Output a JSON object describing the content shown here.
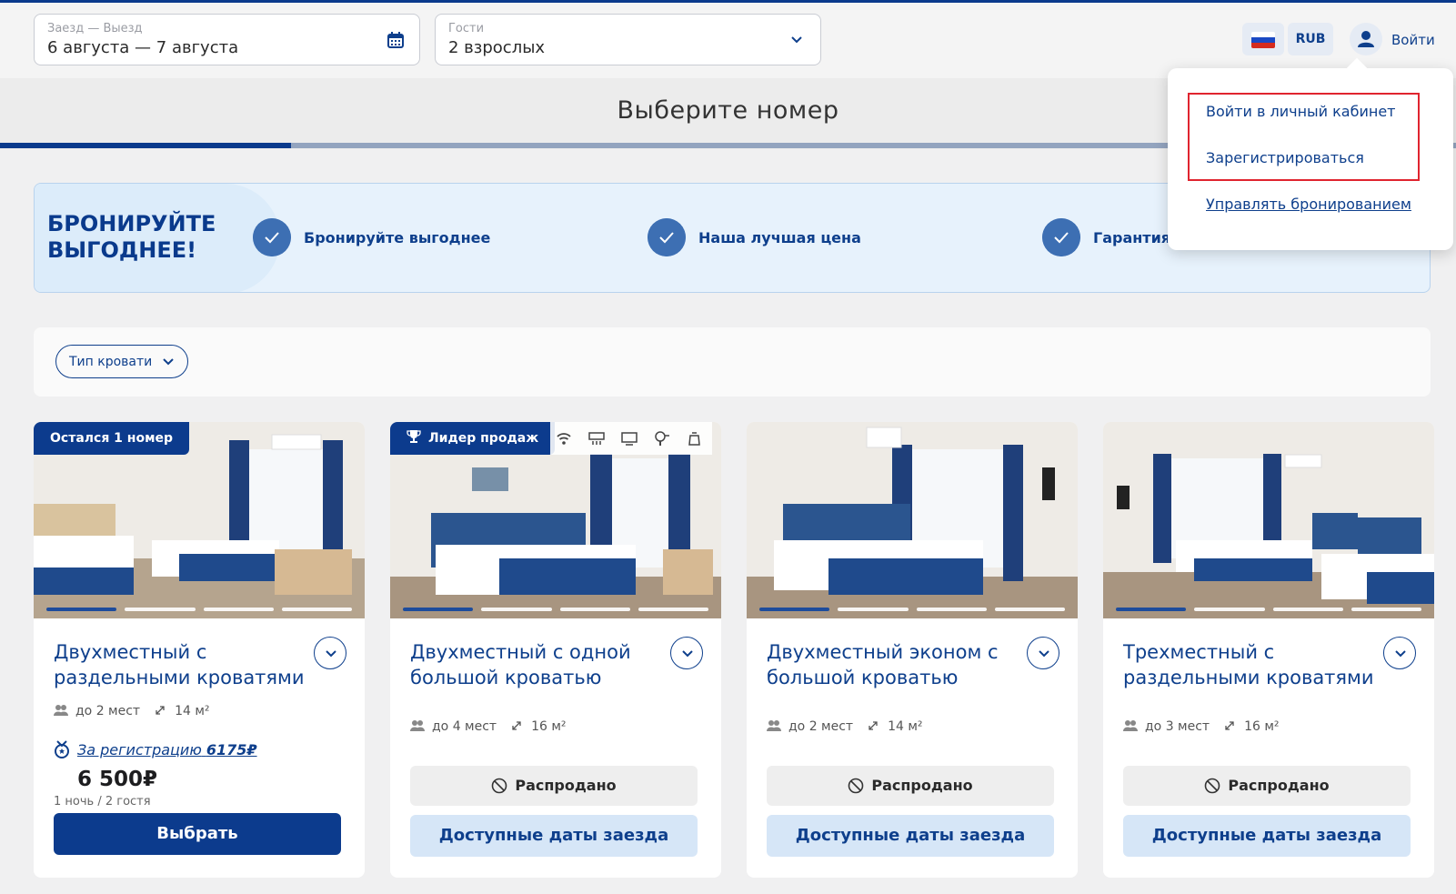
{
  "header": {
    "dates_label": "Заезд — Выезд",
    "dates_value": "6 августа — 7 августа",
    "guests_label": "Гости",
    "guests_value": "2 взрослых",
    "currency": "RUB",
    "login": "Войти"
  },
  "page_title": "Выберите номер",
  "progress_fraction": 0.2,
  "dropdown": {
    "items": [
      "Войти в личный кабинет",
      "Зарегистрироваться",
      "Управлять бронированием"
    ]
  },
  "promo": {
    "heading": "БРОНИРУЙТЕ ВЫГОДНЕЕ!",
    "perks": [
      "Бронируйте выгоднее",
      "Наша лучшая цена",
      "Гарантия"
    ]
  },
  "filters": {
    "bed_type": "Тип кровати"
  },
  "rooms": [
    {
      "badge": "Остался 1 номер",
      "title": "Двухместный с раздельными кроватями",
      "guests": "до 2 мест",
      "area": "14 м²",
      "bonus_prefix": "За регистрацию",
      "bonus_value": "6175₽",
      "price": "6 500₽",
      "per": "1 ночь / 2 гостя",
      "action": "Выбрать"
    },
    {
      "badge": "Лидер продаж",
      "title": "Двухместный с одной большой кроватью",
      "guests": "до 4 мест",
      "area": "16 м²",
      "status": "Распродано",
      "action": "Доступные даты заезда"
    },
    {
      "title": "Двухместный эконом с большой кроватью",
      "guests": "до 2 мест",
      "area": "14 м²",
      "status": "Распродано",
      "action": "Доступные даты заезда"
    },
    {
      "title": "Трехместный с раздельными кроватями",
      "guests": "до 3 мест",
      "area": "16 м²",
      "status": "Распродано",
      "action": "Доступные даты заезда"
    }
  ],
  "colors": {
    "brand": "#0c3b8d",
    "highlight": "#e0242f",
    "secondary_button": "#d6e6f7"
  }
}
